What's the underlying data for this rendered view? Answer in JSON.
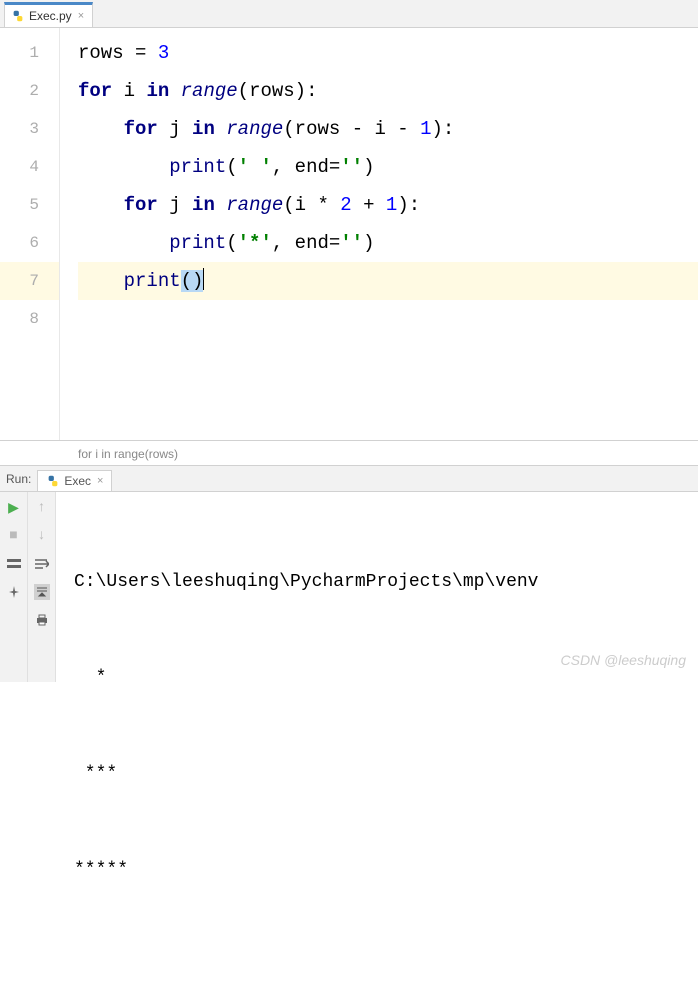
{
  "tab": {
    "filename": "Exec.py"
  },
  "code": {
    "lines": [
      {
        "n": 1,
        "indent": 0,
        "tokens": [
          [
            "plain",
            "rows = "
          ],
          [
            "num",
            "3"
          ]
        ]
      },
      {
        "n": 2,
        "indent": 0,
        "tokens": [
          [
            "kw",
            "for"
          ],
          [
            "plain",
            " i "
          ],
          [
            "kw",
            "in"
          ],
          [
            "plain",
            " "
          ],
          [
            "builtin",
            "range"
          ],
          [
            "plain",
            "(rows):"
          ]
        ]
      },
      {
        "n": 3,
        "indent": 1,
        "tokens": [
          [
            "kw",
            "for"
          ],
          [
            "plain",
            " j "
          ],
          [
            "kw",
            "in"
          ],
          [
            "plain",
            " "
          ],
          [
            "builtin",
            "range"
          ],
          [
            "plain",
            "(rows - i - "
          ],
          [
            "num",
            "1"
          ],
          [
            "plain",
            "):"
          ]
        ]
      },
      {
        "n": 4,
        "indent": 2,
        "tokens": [
          [
            "fn",
            "print"
          ],
          [
            "plain",
            "("
          ],
          [
            "str",
            "' '"
          ],
          [
            "plain",
            ", "
          ],
          [
            "plain",
            "end="
          ],
          [
            "str",
            "''"
          ],
          [
            "plain",
            ")"
          ]
        ]
      },
      {
        "n": 5,
        "indent": 1,
        "tokens": [
          [
            "kw",
            "for"
          ],
          [
            "plain",
            " j "
          ],
          [
            "kw",
            "in"
          ],
          [
            "plain",
            " "
          ],
          [
            "builtin",
            "range"
          ],
          [
            "plain",
            "(i * "
          ],
          [
            "num",
            "2"
          ],
          [
            "plain",
            " + "
          ],
          [
            "num",
            "1"
          ],
          [
            "plain",
            "):"
          ]
        ]
      },
      {
        "n": 6,
        "indent": 2,
        "tokens": [
          [
            "fn",
            "print"
          ],
          [
            "plain",
            "("
          ],
          [
            "str",
            "'*'"
          ],
          [
            "plain",
            ", "
          ],
          [
            "plain",
            "end="
          ],
          [
            "str",
            "''"
          ],
          [
            "plain",
            ")"
          ]
        ]
      },
      {
        "n": 7,
        "indent": 1,
        "current": true,
        "tokens": [
          [
            "fn",
            "print"
          ],
          [
            "paren-hl",
            "("
          ],
          [
            "paren-hl",
            ")"
          ],
          [
            "caret",
            ""
          ]
        ]
      },
      {
        "n": 8,
        "indent": 0,
        "tokens": []
      }
    ]
  },
  "breadcrumb": "for i in range(rows)",
  "run": {
    "label": "Run:",
    "config": "Exec",
    "output_path": "C:\\Users\\leeshuqing\\PycharmProjects\\mp\\venv",
    "output_lines": [
      "  *",
      " ***",
      "*****"
    ]
  },
  "watermark": "CSDN @leeshuqing"
}
